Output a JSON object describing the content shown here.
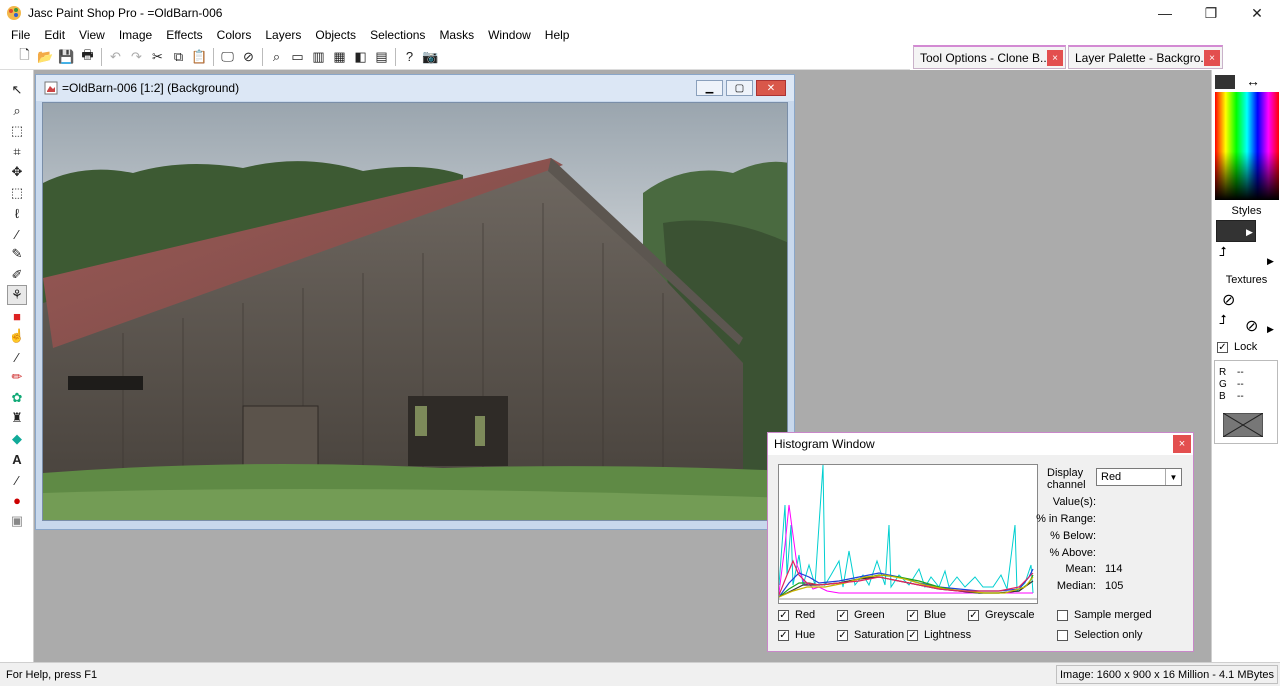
{
  "app": {
    "title": "Jasc Paint Shop Pro - =OldBarn-006"
  },
  "window_controls": {
    "minimize": "—",
    "restore": "❐",
    "close": "✕"
  },
  "menu": [
    "File",
    "Edit",
    "View",
    "Image",
    "Effects",
    "Colors",
    "Layers",
    "Objects",
    "Selections",
    "Masks",
    "Window",
    "Help"
  ],
  "dock": {
    "tool_options": "Tool Options - Clone B...",
    "layer_palette": "Layer Palette - Backgro...",
    "close": "×"
  },
  "image_window": {
    "title": "=OldBarn-006 [1:2] (Background)"
  },
  "right_panel": {
    "styles": "Styles",
    "textures": "Textures",
    "lock": "Lock",
    "r": "R",
    "g": "G",
    "b": "B",
    "r_val": "--",
    "g_val": "--",
    "b_val": "--"
  },
  "histogram": {
    "title": "Histogram Window",
    "close": "×",
    "display_channel_1": "Display",
    "display_channel_2": "channel",
    "channel_value": "Red",
    "stats": {
      "values_label": "Value(s):",
      "in_range_label": "% in Range:",
      "below_label": "% Below:",
      "above_label": "% Above:",
      "mean_label": "Mean:",
      "mean_value": "114",
      "median_label": "Median:",
      "median_value": "105"
    },
    "checks": {
      "red": "Red",
      "green": "Green",
      "blue": "Blue",
      "greyscale": "Greyscale",
      "hue": "Hue",
      "saturation": "Saturation",
      "lightness": "Lightness",
      "sample_merged": "Sample merged",
      "selection_only": "Selection only"
    },
    "colors": {
      "red": "#e0245e",
      "green": "#1aa31a",
      "blue": "#1f3fd9",
      "grey": "#333333",
      "hue": "#ff00ff",
      "saturation": "#00cfd0",
      "lightness": "#c8b400"
    }
  },
  "status": {
    "left": "For Help, press F1",
    "right": "Image:  1600 x 900 x 16 Million - 4.1 MBytes"
  }
}
